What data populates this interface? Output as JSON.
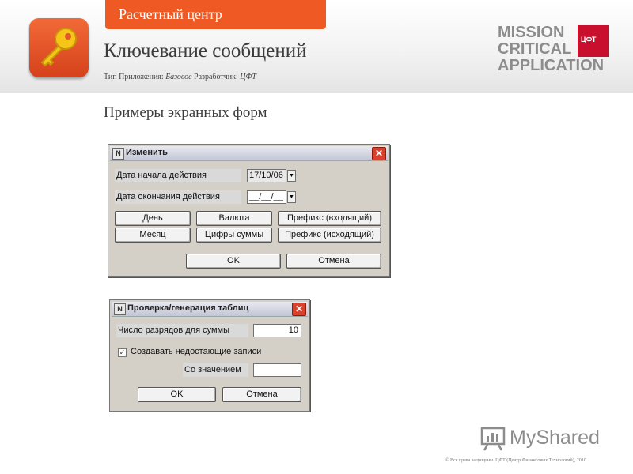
{
  "header": {
    "tab_label": "Расчетный центр",
    "title": "Ключевание сообщений",
    "meta": {
      "type_label": "Тип Приложения:",
      "type_value": "Базовое",
      "dev_label": "Разработчик:",
      "dev_value": "ЦФТ"
    },
    "logo": {
      "line1": "MISSION",
      "line2": "CRITICAL",
      "line3": "APPLICATION",
      "badge": "ЦФТ"
    },
    "colors": {
      "accent": "#ef5a24",
      "logo_red": "#c8102e"
    }
  },
  "section_title": "Примеры экранных форм",
  "dialog_edit": {
    "title": "Изменить",
    "start_label": "Дата начала действия",
    "start_value": "17/10/06",
    "end_label": "Дата окончания действия",
    "end_value": "__/__/__",
    "buttons": {
      "day": "День",
      "currency": "Валюта",
      "prefix_in": "Префикс (входящий)",
      "month": "Месяц",
      "sum_digits": "Цифры суммы",
      "prefix_out": "Префикс (исходящий)",
      "ok": "OK",
      "cancel": "Отмена"
    }
  },
  "dialog_check": {
    "title": "Проверка/генерация таблиц",
    "digits_label": "Число разрядов для суммы",
    "digits_value": "10",
    "create_missing_label": "Создавать недостающие записи",
    "create_missing_checked": true,
    "with_value_label": "Со значением",
    "with_value": "",
    "ok": "OK",
    "cancel": "Отмена"
  },
  "watermark": "MyShared",
  "footer": "© Все права защищены. ЦФТ (Центр Финансовых Технологий), 2010"
}
